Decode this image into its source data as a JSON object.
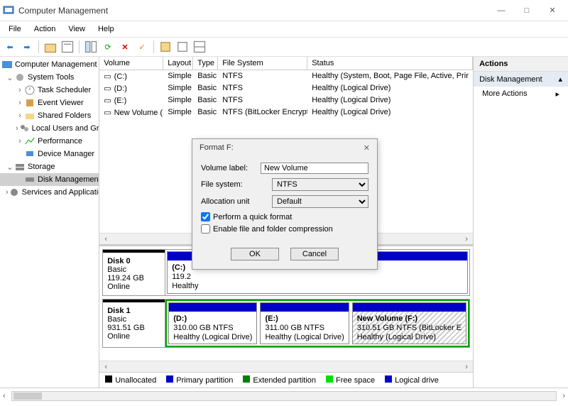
{
  "titlebar": {
    "title": "Computer Management"
  },
  "menu": {
    "file": "File",
    "action": "Action",
    "view": "View",
    "help": "Help"
  },
  "tree": {
    "root": "Computer Management (Local",
    "systools": "System Tools",
    "task": "Task Scheduler",
    "event": "Event Viewer",
    "shared": "Shared Folders",
    "users": "Local Users and Groups",
    "perf": "Performance",
    "devmgr": "Device Manager",
    "storage": "Storage",
    "diskmgmt": "Disk Management",
    "services": "Services and Applications"
  },
  "cols": {
    "volume": "Volume",
    "layout": "Layout",
    "type": "Type",
    "fs": "File System",
    "status": "Status"
  },
  "rows": [
    {
      "v": "(C:)",
      "l": "Simple",
      "t": "Basic",
      "f": "NTFS",
      "s": "Healthy (System, Boot, Page File, Active, Prir"
    },
    {
      "v": "(D:)",
      "l": "Simple",
      "t": "Basic",
      "f": "NTFS",
      "s": "Healthy (Logical Drive)"
    },
    {
      "v": "(E:)",
      "l": "Simple",
      "t": "Basic",
      "f": "NTFS",
      "s": "Healthy (Logical Drive)"
    },
    {
      "v": "New Volume (F:)",
      "l": "Simple",
      "t": "Basic",
      "f": "NTFS (BitLocker Encrypted)",
      "s": "Healthy (Logical Drive)"
    }
  ],
  "disks": {
    "d0": {
      "name": "Disk 0",
      "type": "Basic",
      "size": "119.24 GB",
      "state": "Online",
      "parts": [
        {
          "label": "(C:)",
          "line2": "119.2",
          "line3": "Healthy"
        }
      ]
    },
    "d1": {
      "name": "Disk 1",
      "type": "Basic",
      "size": "931.51 GB",
      "state": "Online",
      "parts": [
        {
          "label": "(D:)",
          "line2": "310.00 GB NTFS",
          "line3": "Healthy (Logical Drive)"
        },
        {
          "label": "(E:)",
          "line2": "311.00 GB NTFS",
          "line3": "Healthy (Logical Drive)"
        },
        {
          "label": "New Volume   (F:)",
          "line2": "310.51 GB NTFS (BitLocker E",
          "line3": "Healthy (Logical Drive)"
        }
      ]
    }
  },
  "legend": {
    "un": "Unallocated",
    "pri": "Primary partition",
    "ext": "Extended partition",
    "free": "Free space",
    "log": "Logical drive"
  },
  "actions": {
    "hdr": "Actions",
    "dm": "Disk Management",
    "more": "More Actions"
  },
  "dialog": {
    "title": "Format F:",
    "vlabel": "Volume label:",
    "vval": "New Volume",
    "fslabel": "File system:",
    "fsval": "NTFS",
    "aulabel": "Allocation unit",
    "auval": "Default",
    "quick": "Perform a quick format",
    "compress": "Enable file and folder compression",
    "ok": "OK",
    "cancel": "Cancel"
  }
}
